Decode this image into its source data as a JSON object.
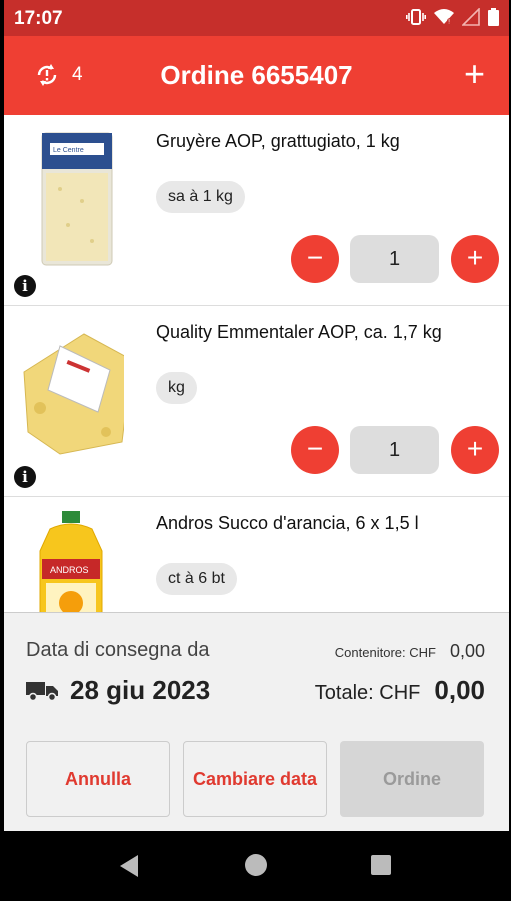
{
  "status_bar": {
    "time": "17:07",
    "icons": [
      "vibrate-icon",
      "wifi-icon",
      "signal-icon",
      "battery-icon"
    ]
  },
  "app_bar": {
    "sync_count": "4",
    "title": "Ordine 6655407",
    "icons": {
      "sync": "sync-alert-icon",
      "add": "plus-icon"
    }
  },
  "colors": {
    "primary": "#ef3f33",
    "status_bar": "#c62f2b",
    "disabled": "#d6d6d6"
  },
  "items": [
    {
      "name": "Gruyère AOP, grattugiato, 1 kg",
      "unit": "sa à 1 kg",
      "quantity": "1"
    },
    {
      "name": "Quality Emmentaler AOP, ca. 1,7 kg",
      "unit": "kg",
      "quantity": "1"
    },
    {
      "name": "Andros Succo d'arancia, 6 x 1,5 l",
      "unit": "ct à 6 bt",
      "quantity": ""
    }
  ],
  "footer": {
    "delivery_label": "Data di consegna da",
    "delivery_date": "28 giu 2023",
    "container_label": "Contenitore: CHF",
    "container_value": "0,00",
    "total_label": "Totale: CHF",
    "total_value": "0,00"
  },
  "actions": {
    "cancel": "Annulla",
    "change_date": "Cambiare data",
    "order": "Ordine"
  }
}
